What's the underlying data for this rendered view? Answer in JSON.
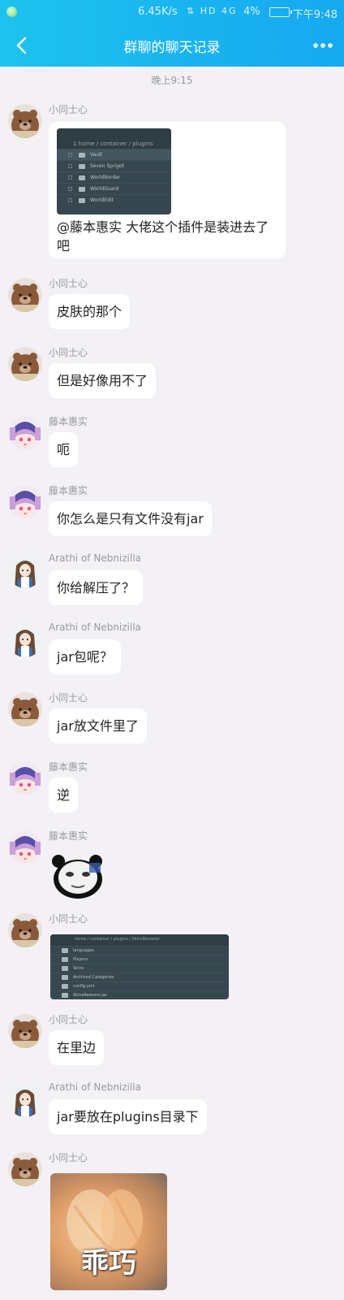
{
  "status_bar": {
    "network_speed": "6.45K/s",
    "icons_text": "⇅ HD 4G",
    "battery_percent": "4%",
    "time": "下午9:48"
  },
  "header": {
    "title": "群聊的聊天记录"
  },
  "timestamp": "晚上9:15",
  "messages": [
    {
      "sender": "小同士心",
      "image_filename": "1 home / container / plugins",
      "image_rows": [
        "Vault",
        "Seven Sprigot",
        "WorldBorder",
        "WorldGuard",
        "WorldEdit"
      ],
      "text": "@藤本惠实 大佬这个插件是装进去了吧"
    },
    {
      "sender": "小同士心",
      "text": "皮肤的那个"
    },
    {
      "sender": "小同士心",
      "text": "但是好像用不了"
    },
    {
      "sender": "藤本惠实",
      "text": "呃"
    },
    {
      "sender": "藤本惠实",
      "text": "你怎么是只有文件没有jar"
    },
    {
      "sender": "Arathi of Nebnizilla",
      "text": "你给解压了？"
    },
    {
      "sender": "Arathi of Nebnizilla",
      "text": "jar包呢？"
    },
    {
      "sender": "小同士心",
      "text": "jar放文件里了"
    },
    {
      "sender": "藤本惠实",
      "text": "逆"
    },
    {
      "sender": "藤本惠实"
    },
    {
      "sender": "小同士心",
      "image_filename": "home / container / plugins / SkinsRestorer",
      "image_rows": [
        "languages",
        "Players",
        "Skins",
        "Archived Categories",
        "config.yml",
        "SkinsRestorer.jar"
      ]
    },
    {
      "sender": "小同士心",
      "text": "在里边"
    },
    {
      "sender": "Arathi of Nebnizilla",
      "text": "jar要放在plugins目录下"
    },
    {
      "sender": "小同士心",
      "sticker_text": "乖巧"
    }
  ]
}
